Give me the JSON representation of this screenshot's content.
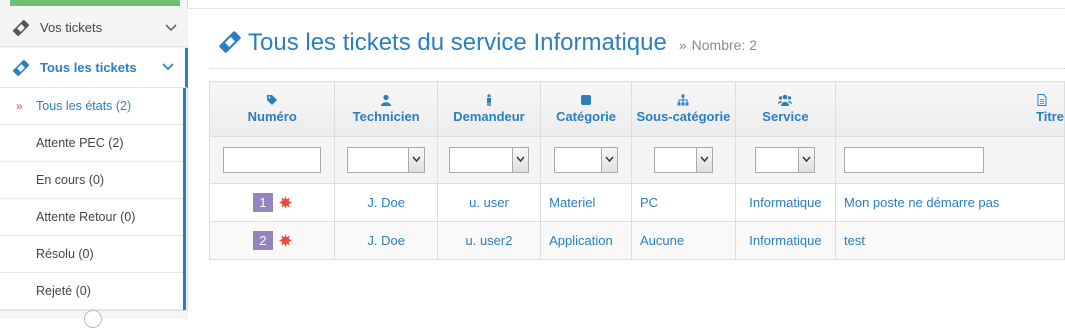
{
  "sidebar": {
    "items": [
      {
        "label": "Vos tickets",
        "icon": "ticket-icon"
      },
      {
        "label": "Tous les tickets",
        "icon": "ticket-icon"
      }
    ],
    "subitems": [
      {
        "label": "Tous les états (2)",
        "active": true
      },
      {
        "label": "Attente PEC (2)"
      },
      {
        "label": "En cours (0)"
      },
      {
        "label": "Attente Retour (0)"
      },
      {
        "label": "Résolu (0)"
      },
      {
        "label": "Rejeté (0)"
      }
    ]
  },
  "header": {
    "title": "Tous les tickets du service Informatique",
    "count": "Nombre: 2"
  },
  "table": {
    "columns": [
      {
        "label": "Numéro",
        "icon": "tag-icon"
      },
      {
        "label": "Technicien",
        "icon": "user-icon"
      },
      {
        "label": "Demandeur",
        "icon": "male-icon"
      },
      {
        "label": "Catégorie",
        "icon": "stop-icon"
      },
      {
        "label": "Sous-catégorie",
        "icon": "sitemap-icon"
      },
      {
        "label": "Service",
        "icon": "users-icon"
      },
      {
        "label": "Titre",
        "icon": "file-icon"
      }
    ],
    "rows": [
      {
        "id": "1",
        "technicien": "J. Doe",
        "demandeur": "u. user",
        "categorie": "Materiel",
        "sous_categorie": "PC",
        "service": "Informatique",
        "titre": "Mon poste ne démarre pas"
      },
      {
        "id": "2",
        "technicien": "J. Doe",
        "demandeur": "u. user2",
        "categorie": "Application",
        "sous_categorie": "Aucune",
        "service": "Informatique",
        "titre": "test"
      }
    ]
  },
  "colors": {
    "accent": "#2a7fc0",
    "badge": "#9585bf",
    "new_marker": "#e74c3c"
  }
}
